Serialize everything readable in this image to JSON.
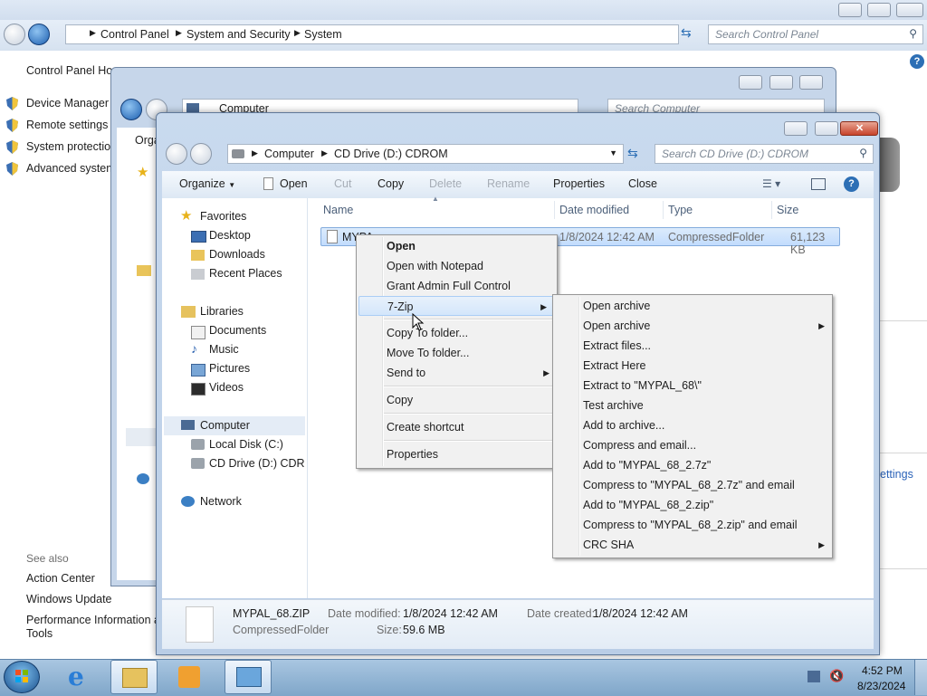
{
  "control_panel": {
    "breadcrumb": [
      "Control Panel",
      "System and Security",
      "System"
    ],
    "search_placeholder": "Search Control Panel",
    "home_link": "Control Panel Home",
    "tasks": [
      "Device Manager",
      "Remote settings",
      "System protection",
      "Advanced system settings"
    ],
    "see_also_title": "See also",
    "see_also": [
      "Action Center",
      "Windows Update",
      "Performance Information and",
      "Tools"
    ],
    "right_partial_link": "ettings"
  },
  "computer_window": {
    "breadcrumb": [
      "Computer"
    ],
    "search_placeholder": "Search Computer",
    "organize_partial": "Orga"
  },
  "cd_window": {
    "breadcrumb": [
      "Computer",
      "CD Drive (D:) CDROM"
    ],
    "search_placeholder": "Search CD Drive (D:) CDROM",
    "toolbar": {
      "organize": "Organize",
      "open": "Open",
      "cut": "Cut",
      "copy": "Copy",
      "delete": "Delete",
      "rename": "Rename",
      "properties": "Properties",
      "close": "Close"
    },
    "nav": {
      "favorites": "Favorites",
      "desktop": "Desktop",
      "downloads": "Downloads",
      "recent": "Recent Places",
      "libraries": "Libraries",
      "documents": "Documents",
      "music": "Music",
      "pictures": "Pictures",
      "videos": "Videos",
      "computer": "Computer",
      "local_disk": "Local Disk (C:)",
      "cd_drive": "CD Drive (D:) CDROM",
      "network": "Network"
    },
    "columns": {
      "name": "Name",
      "date": "Date modified",
      "type": "Type",
      "size": "Size"
    },
    "file": {
      "name": "MYPAL_68.ZIP",
      "name_partial": "MYPA",
      "date": "1/8/2024 12:42 AM",
      "type": "CompressedFolder",
      "size": "61,123 KB"
    },
    "details": {
      "name": "MYPAL_68.ZIP",
      "type": "CompressedFolder",
      "date_modified_label": "Date modified:",
      "date_modified": "1/8/2024 12:42 AM",
      "size_label": "Size:",
      "size": "59.6 MB",
      "date_created_label": "Date created:",
      "date_created": "1/8/2024 12:42 AM"
    }
  },
  "context_menu": {
    "items": [
      "Open",
      "Open with Notepad",
      "Grant Admin Full Control",
      "7-Zip",
      "Copy To folder...",
      "Move To folder...",
      "Send to",
      "Copy",
      "Create shortcut",
      "Properties"
    ]
  },
  "zip_submenu": {
    "items": [
      "Open archive",
      "Open archive",
      "Extract files...",
      "Extract Here",
      "Extract to \"MYPAL_68\\\"",
      "Test archive",
      "Add to archive...",
      "Compress and email...",
      "Add to \"MYPAL_68_2.7z\"",
      "Compress to \"MYPAL_68_2.7z\" and email",
      "Add to \"MYPAL_68_2.zip\"",
      "Compress to \"MYPAL_68_2.zip\" and email",
      "CRC SHA"
    ]
  },
  "taskbar": {
    "time": "4:52 PM",
    "date": "8/23/2024"
  },
  "colors": {
    "accent": "#3a6fb0",
    "menu_bg": "#f1f1f1",
    "taskbar": "#7fa6c9"
  }
}
